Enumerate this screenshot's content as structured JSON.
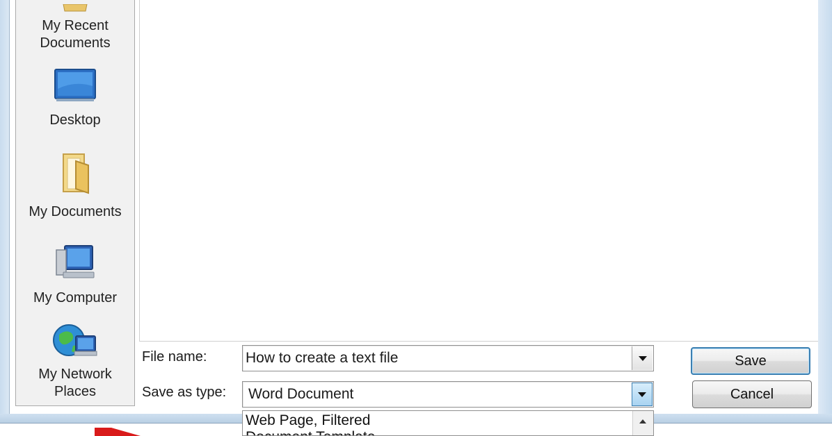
{
  "places_bar": {
    "items": [
      {
        "label": "My Recent\nDocuments",
        "icon": "recent-documents-icon"
      },
      {
        "label": "Desktop",
        "icon": "desktop-icon"
      },
      {
        "label": "My Documents",
        "icon": "my-documents-folder-icon"
      },
      {
        "label": "My Computer",
        "icon": "my-computer-icon"
      },
      {
        "label": "My Network\nPlaces",
        "icon": "network-places-icon"
      }
    ]
  },
  "form": {
    "file_name_label": "File name:",
    "file_name_value": "How to create a text file",
    "save_as_type_label": "Save as type:",
    "save_as_type_value": "Word Document"
  },
  "buttons": {
    "save": "Save",
    "cancel": "Cancel"
  },
  "dropdown": {
    "options": [
      "Web Page, Filtered",
      "Document Template"
    ]
  },
  "colors": {
    "accent": "#3c7fb1",
    "annotation_arrow": "#d91b1b"
  }
}
